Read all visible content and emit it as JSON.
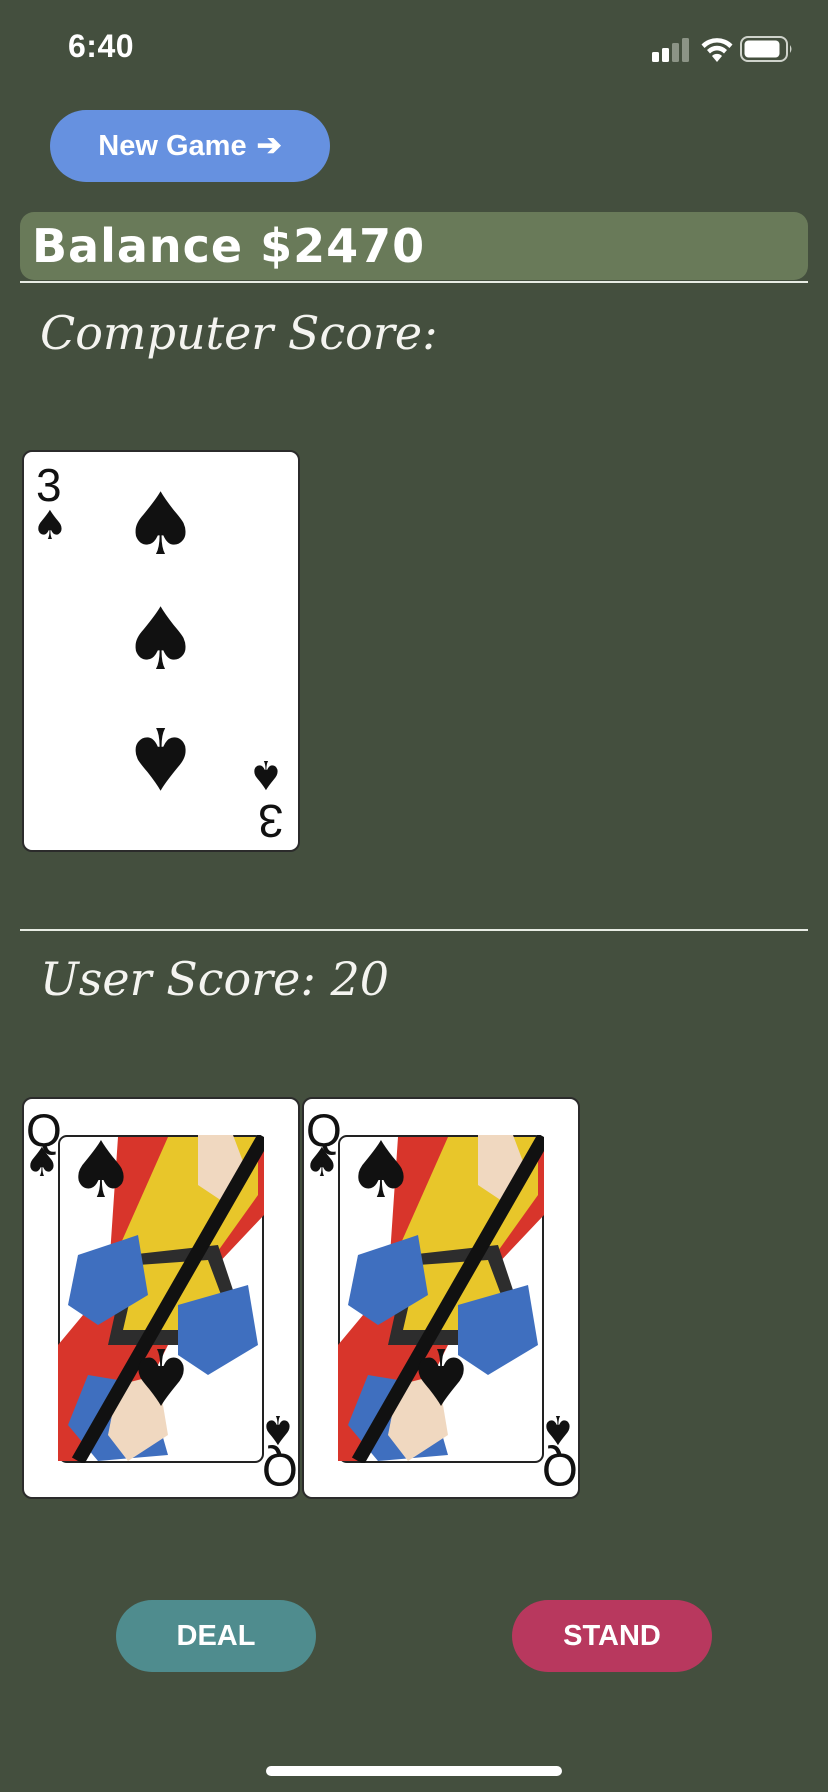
{
  "status_bar": {
    "time": "6:40",
    "icons": [
      "signal-icon",
      "wifi-icon",
      "battery-icon"
    ]
  },
  "header": {
    "new_game_label": "New Game",
    "new_game_icon": "arrow-right-icon",
    "balance_text": "Balance $2470"
  },
  "computer": {
    "score_label": "Computer Score:",
    "cards": [
      {
        "rank": "3",
        "suit": "spades",
        "suit_symbol": "♠"
      }
    ]
  },
  "user": {
    "score_label": "User Score: 20",
    "cards": [
      {
        "rank": "Q",
        "suit": "spades",
        "suit_symbol": "♠"
      },
      {
        "rank": "Q",
        "suit": "spades",
        "suit_symbol": "♠"
      }
    ]
  },
  "actions": {
    "deal_label": "DEAL",
    "stand_label": "STAND"
  },
  "colors": {
    "background": "#444f3e",
    "balance_bar": "#697a59",
    "new_game_button": "#6691e0",
    "deal_button": "#4f8c8e",
    "stand_button": "#b8385e"
  }
}
